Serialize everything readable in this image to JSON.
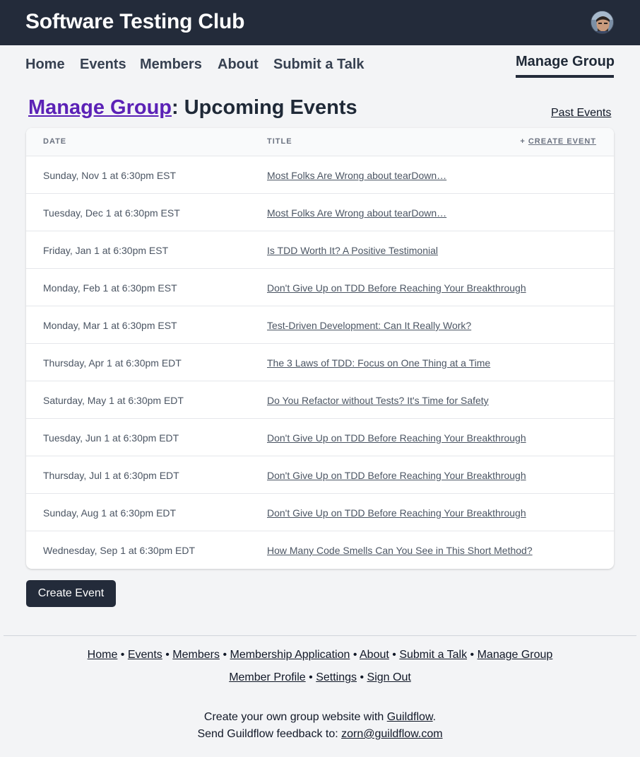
{
  "header": {
    "site_title": "Software Testing Club",
    "avatar_alt": "user-avatar"
  },
  "nav": {
    "items": [
      "Home",
      "Events",
      "Members",
      "About",
      "Submit a Talk"
    ],
    "active": "Manage Group"
  },
  "page": {
    "heading_link": "Manage Group",
    "heading_rest": ": Upcoming Events",
    "past_events": "Past Events"
  },
  "table": {
    "col_date": "DATE",
    "col_title": "TITLE",
    "create_prefix": "+",
    "create_label": "CREATE EVENT",
    "rows": [
      {
        "date": "Sunday, Nov 1 at 6:30pm EST",
        "title": "Most Folks Are Wrong about tearDown…"
      },
      {
        "date": "Tuesday, Dec 1 at 6:30pm EST",
        "title": "Most Folks Are Wrong about tearDown…"
      },
      {
        "date": "Friday, Jan 1 at 6:30pm EST",
        "title": "Is TDD Worth It? A Positive Testimonial"
      },
      {
        "date": "Monday, Feb 1 at 6:30pm EST",
        "title": "Don't Give Up on TDD Before Reaching Your Breakthrough"
      },
      {
        "date": "Monday, Mar 1 at 6:30pm EST",
        "title": "Test-Driven Development: Can It Really Work?"
      },
      {
        "date": "Thursday, Apr 1 at 6:30pm EDT",
        "title": "The 3 Laws of TDD: Focus on One Thing at a Time"
      },
      {
        "date": "Saturday, May 1 at 6:30pm EDT",
        "title": "Do You Refactor without Tests? It's Time for Safety"
      },
      {
        "date": "Tuesday, Jun 1 at 6:30pm EDT",
        "title": "Don't Give Up on TDD Before Reaching Your Breakthrough"
      },
      {
        "date": "Thursday, Jul 1 at 6:30pm EDT",
        "title": "Don't Give Up on TDD Before Reaching Your Breakthrough"
      },
      {
        "date": "Sunday, Aug 1 at 6:30pm EDT",
        "title": "Don't Give Up on TDD Before Reaching Your Breakthrough"
      },
      {
        "date": "Wednesday, Sep 1 at 6:30pm EDT",
        "title": "How Many Code Smells Can You See in This Short Method?"
      }
    ]
  },
  "create_button": "Create Event",
  "footer": {
    "links_row1": [
      "Home",
      "Events",
      "Members",
      "Membership Application",
      "About",
      "Submit a Talk",
      "Manage Group"
    ],
    "links_row2": [
      "Member Profile",
      "Settings",
      "Sign Out"
    ],
    "separator": "•",
    "line1_prefix": "Create your own group website with ",
    "line1_link": "Guildflow",
    "line1_suffix": ".",
    "line2_prefix": "Send Guildflow feedback to: ",
    "line2_link": "zorn@guildflow.com"
  },
  "colors": {
    "topbar": "#232b3a",
    "accent_link": "#5b21b6",
    "background": "#f3f4f6"
  }
}
